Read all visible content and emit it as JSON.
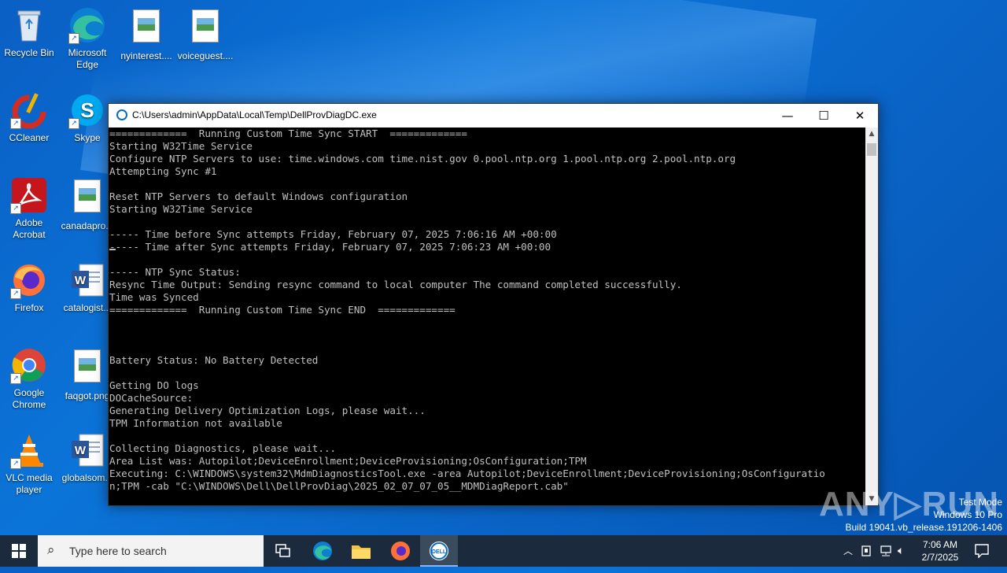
{
  "desktop": {
    "icons": [
      {
        "label": "Recycle Bin"
      },
      {
        "label": "Microsoft Edge"
      },
      {
        "label": "nyinterest...."
      },
      {
        "label": "voiceguest...."
      },
      {
        "label": "CCleaner"
      },
      {
        "label": "Skype"
      },
      {
        "label": "Adobe Acrobat"
      },
      {
        "label": "canadapro..."
      },
      {
        "label": "Firefox"
      },
      {
        "label": "catalogist..."
      },
      {
        "label": "Google Chrome"
      },
      {
        "label": "faqgot.png"
      },
      {
        "label": "VLC media player"
      },
      {
        "label": "globalsom..."
      }
    ]
  },
  "window": {
    "title": "C:\\Users\\admin\\AppData\\Local\\Temp\\DellProvDiagDC.exe",
    "minimize_glyph": "—",
    "maximize_glyph": "☐",
    "close_glyph": "✕",
    "console_lines": [
      "=============  Running Custom Time Sync START  =============",
      "Starting W32Time Service",
      "Configure NTP Servers to use: time.windows.com time.nist.gov 0.pool.ntp.org 1.pool.ntp.org 2.pool.ntp.org",
      "Attempting Sync #1",
      "",
      "Reset NTP Servers to default Windows configuration",
      "Starting W32Time Service",
      "",
      "----- Time before Sync attempts Friday, February 07, 2025 7:06:16 AM +00:00",
      "----- Time after Sync attempts Friday, February 07, 2025 7:06:23 AM +00:00",
      "",
      "----- NTP Sync Status:",
      "Resync Time Output: Sending resync command to local computer The command completed successfully.",
      "Time was Synced",
      "=============  Running Custom Time Sync END  =============",
      "",
      "",
      "",
      "Battery Status: No Battery Detected",
      "",
      "Getting DO logs",
      "DOCacheSource:",
      "Generating Delivery Optimization Logs, please wait...",
      "TPM Information not available",
      "",
      "Collecting Diagnostics, please wait...",
      "Area List was: Autopilot;DeviceEnrollment;DeviceProvisioning;OsConfiguration;TPM",
      "Executing: C:\\WINDOWS\\system32\\MdmDiagnosticsTool.exe -area Autopilot;DeviceEnrollment;DeviceProvisioning;OsConfiguratio",
      "n;TPM -cab \"C:\\WINDOWS\\Dell\\DellProvDiag\\2025_02_07_07_05__MDMDiagReport.cab\""
    ]
  },
  "watermark": {
    "text": "ANY▷RUN"
  },
  "system_info": {
    "line1": "Test Mode",
    "line2": "Windows 10 Pro",
    "line3": "Build 19041.vb_release.191206-1406"
  },
  "taskbar": {
    "search_placeholder": "Type here to search",
    "time": "7:06 AM",
    "date": "2/7/2025"
  }
}
